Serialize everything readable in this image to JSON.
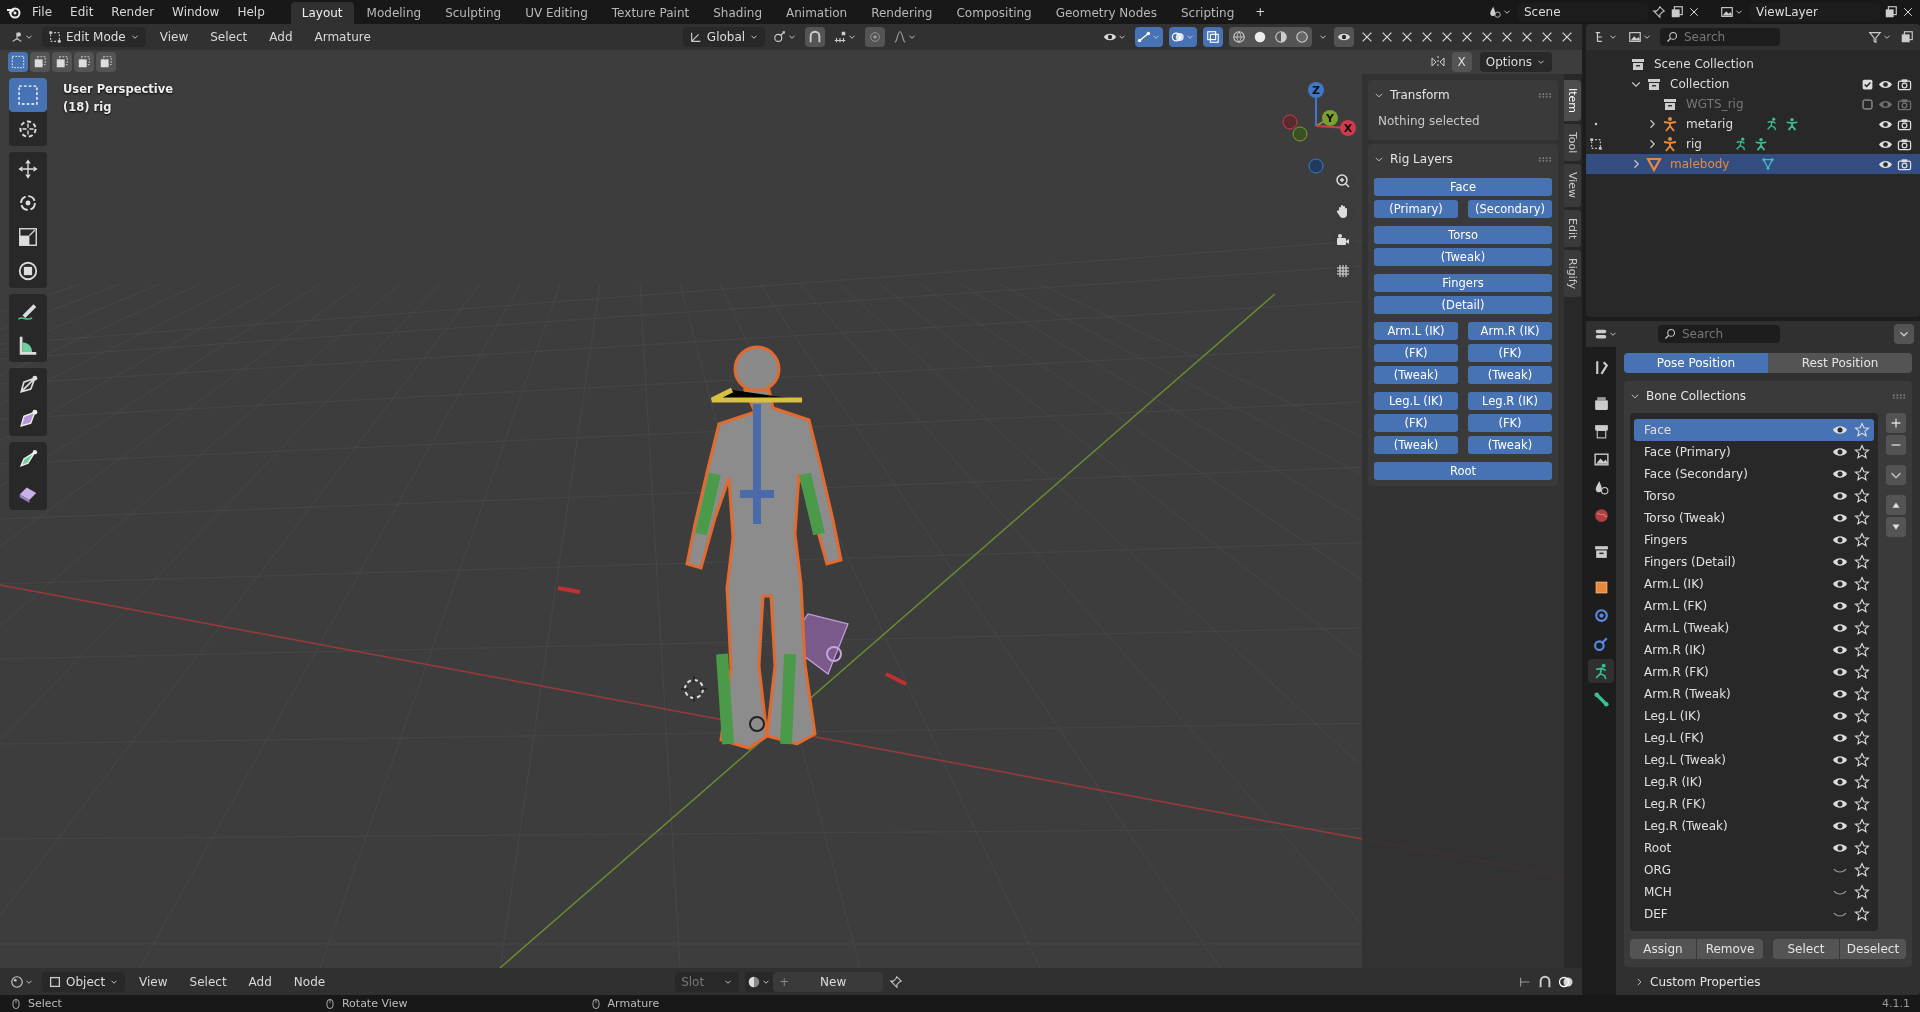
{
  "topbar": {
    "menus": [
      "File",
      "Edit",
      "Render",
      "Window",
      "Help"
    ],
    "workspaces": [
      {
        "label": "Layout",
        "selected": true
      },
      {
        "label": "Modeling",
        "selected": false
      },
      {
        "label": "Sculpting",
        "selected": false
      },
      {
        "label": "UV Editing",
        "selected": false
      },
      {
        "label": "Texture Paint",
        "selected": false
      },
      {
        "label": "Shading",
        "selected": false
      },
      {
        "label": "Animation",
        "selected": false
      },
      {
        "label": "Rendering",
        "selected": false
      },
      {
        "label": "Compositing",
        "selected": false
      },
      {
        "label": "Geometry Nodes",
        "selected": false
      },
      {
        "label": "Scripting",
        "selected": false
      }
    ],
    "add_tab": "+",
    "scene": "Scene",
    "view_layer": "ViewLayer"
  },
  "viewport": {
    "mode": "Edit Mode",
    "menus": [
      "View",
      "Select",
      "Add",
      "Armature"
    ],
    "orientation": "Global",
    "mirror": "X",
    "options": "Options",
    "view_name": "User Perspective",
    "object_info": "(18) rig",
    "axes": [
      {
        "label": "Z",
        "kind": "z"
      },
      {
        "label": "Y",
        "kind": "y"
      },
      {
        "label": "X",
        "kind": "x"
      }
    ],
    "sidebar_tabs": [
      {
        "label": "Item",
        "selected": true
      },
      {
        "label": "Tool",
        "selected": false
      },
      {
        "label": "View",
        "selected": false
      },
      {
        "label": "Edit",
        "selected": false
      },
      {
        "label": "Rigify",
        "selected": false
      }
    ],
    "transform": {
      "title": "Transform",
      "expanded": true,
      "text": "Nothing selected"
    },
    "rig_layers": {
      "title": "Rig Layers",
      "expanded": true,
      "groups": [
        [
          [
            "Face"
          ],
          [
            "(Primary)",
            "(Secondary)"
          ]
        ],
        [
          [
            "Torso"
          ],
          [
            "(Tweak)"
          ]
        ],
        [
          [
            "Fingers"
          ],
          [
            "(Detail)"
          ]
        ],
        [
          [
            "Arm.L (IK)",
            "Arm.R (IK)"
          ],
          [
            "(FK)",
            "(FK)"
          ],
          [
            "(Tweak)",
            "(Tweak)"
          ]
        ],
        [
          [
            "Leg.L (IK)",
            "Leg.R (IK)"
          ],
          [
            "(FK)",
            "(FK)"
          ],
          [
            "(Tweak)",
            "(Tweak)"
          ]
        ],
        [
          [
            "Root"
          ]
        ]
      ]
    }
  },
  "outliner": {
    "search": {
      "placeholder": "Search"
    },
    "items": [
      {
        "label": "Scene Collection",
        "kind": "scene",
        "selected": false,
        "children": [
          {
            "label": "Collection",
            "kind": "collection",
            "expanded": true,
            "checked": true,
            "selected": false,
            "children": [
              {
                "label": "WGTS_rig",
                "kind": "collection",
                "checked": false,
                "selected": false
              },
              {
                "label": "metarig",
                "kind": "armature",
                "expanded": false,
                "in_edit_mode": false,
                "selected": false
              },
              {
                "label": "rig",
                "kind": "armature",
                "expanded": false,
                "in_edit_mode": true,
                "selected": false
              }
            ]
          },
          {
            "label": "malebody",
            "kind": "mesh",
            "expanded": false,
            "selected": true
          }
        ]
      }
    ]
  },
  "properties": {
    "search": {
      "placeholder": "Search"
    },
    "tabs": [
      {
        "kind": "tool",
        "selected": false
      },
      {
        "kind": "render",
        "selected": false
      },
      {
        "kind": "output",
        "selected": false
      },
      {
        "kind": "view_layer",
        "selected": false
      },
      {
        "kind": "scene",
        "selected": false
      },
      {
        "kind": "world",
        "selected": false
      },
      {
        "kind": "collection",
        "selected": false
      },
      {
        "kind": "object",
        "selected": false
      },
      {
        "kind": "physics",
        "selected": false
      },
      {
        "kind": "constraints",
        "selected": false
      },
      {
        "kind": "data",
        "selected": true
      },
      {
        "kind": "bone",
        "selected": false
      }
    ],
    "positions": [
      {
        "label": "Pose Position",
        "selected": true
      },
      {
        "label": "Rest Position",
        "selected": false
      }
    ],
    "bone_collections": {
      "title": "Bone Collections",
      "expanded": true,
      "items": [
        {
          "name": "Face",
          "selected": true,
          "visible": true
        },
        {
          "name": "Face (Primary)",
          "selected": false,
          "visible": true
        },
        {
          "name": "Face (Secondary)",
          "selected": false,
          "visible": true
        },
        {
          "name": "Torso",
          "selected": false,
          "visible": true
        },
        {
          "name": "Torso (Tweak)",
          "selected": false,
          "visible": true
        },
        {
          "name": "Fingers",
          "selected": false,
          "visible": true
        },
        {
          "name": "Fingers (Detail)",
          "selected": false,
          "visible": true
        },
        {
          "name": "Arm.L (IK)",
          "selected": false,
          "visible": true
        },
        {
          "name": "Arm.L (FK)",
          "selected": false,
          "visible": true
        },
        {
          "name": "Arm.L (Tweak)",
          "selected": false,
          "visible": true
        },
        {
          "name": "Arm.R (IK)",
          "selected": false,
          "visible": true
        },
        {
          "name": "Arm.R (FK)",
          "selected": false,
          "visible": true
        },
        {
          "name": "Arm.R (Tweak)",
          "selected": false,
          "visible": true
        },
        {
          "name": "Leg.L (IK)",
          "selected": false,
          "visible": true
        },
        {
          "name": "Leg.L (FK)",
          "selected": false,
          "visible": true
        },
        {
          "name": "Leg.L (Tweak)",
          "selected": false,
          "visible": true
        },
        {
          "name": "Leg.R (IK)",
          "selected": false,
          "visible": true
        },
        {
          "name": "Leg.R (FK)",
          "selected": false,
          "visible": true
        },
        {
          "name": "Leg.R (Tweak)",
          "selected": false,
          "visible": true
        },
        {
          "name": "Root",
          "selected": false,
          "visible": true
        },
        {
          "name": "ORG",
          "selected": false,
          "visible": false
        },
        {
          "name": "MCH",
          "selected": false,
          "visible": false
        },
        {
          "name": "DEF",
          "selected": false,
          "visible": false
        }
      ],
      "actions": [
        "Assign",
        "Remove",
        "Select",
        "Deselect"
      ]
    },
    "custom_properties": {
      "title": "Custom Properties",
      "expanded": false
    }
  },
  "shader_header": {
    "mode": "Object",
    "menus": [
      "View",
      "Select",
      "Add",
      "Node"
    ],
    "slot": {
      "placeholder": "Slot"
    },
    "new_label": "New",
    "add_icon": "+"
  },
  "status_bar": {
    "hints": [
      "Select",
      "Rotate View",
      "Armature"
    ],
    "version": "4.1.1"
  }
}
